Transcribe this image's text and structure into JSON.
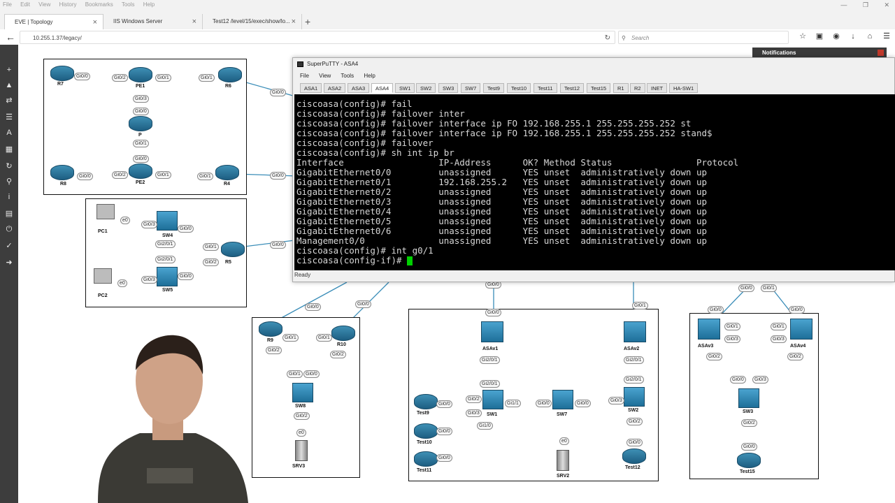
{
  "browser": {
    "menu": [
      "File",
      "Edit",
      "View",
      "History",
      "Bookmarks",
      "Tools",
      "Help"
    ],
    "tabs": [
      {
        "label": "EVE | Topology",
        "active": true
      },
      {
        "label": "IIS Windows Server",
        "active": false
      },
      {
        "label": "Test12 /level/15/exec/show/lo...",
        "active": false
      }
    ],
    "url": "10.255.1.37/legacy/",
    "search_placeholder": "Search"
  },
  "notifications": {
    "title": "Notifications"
  },
  "putty": {
    "title": "SuperPuTTY - ASA4",
    "menu": [
      "File",
      "View",
      "Tools",
      "Help"
    ],
    "tabs": [
      "ASA1",
      "ASA2",
      "ASA3",
      "ASA4",
      "SW1",
      "SW2",
      "SW3",
      "SW7",
      "Test9",
      "Test10",
      "Test11",
      "Test12",
      "Test15",
      "R1",
      "R2",
      "INET",
      "HA-SW1"
    ],
    "active_tab": "ASA4",
    "status": "Ready",
    "terminal_lines": [
      "ciscoasa(config)# fail",
      "ciscoasa(config)# failover inter",
      "ciscoasa(config)# failover interface ip FO 192.168.255.1 255.255.255.252 st",
      "ciscoasa(config)# failover interface ip FO 192.168.255.1 255.255.255.252 stand$",
      "ciscoasa(config)# failover",
      "ciscoasa(config)# sh int ip br",
      "Interface                  IP-Address      OK? Method Status                Protocol",
      "GigabitEthernet0/0         unassigned      YES unset  administratively down up",
      "GigabitEthernet0/1         192.168.255.2   YES unset  administratively down up",
      "GigabitEthernet0/2         unassigned      YES unset  administratively down up",
      "GigabitEthernet0/3         unassigned      YES unset  administratively down up",
      "GigabitEthernet0/4         unassigned      YES unset  administratively down up",
      "GigabitEthernet0/5         unassigned      YES unset  administratively down up",
      "GigabitEthernet0/6         unassigned      YES unset  administratively down up",
      "Management0/0              unassigned      YES unset  administratively down up",
      "ciscoasa(config)# int g0/1",
      "ciscoasa(config-if)# "
    ]
  },
  "topology": {
    "devices": [
      {
        "name": "R7",
        "type": "router"
      },
      {
        "name": "PE1",
        "type": "router"
      },
      {
        "name": "R6",
        "type": "router"
      },
      {
        "name": "P",
        "type": "router"
      },
      {
        "name": "R8",
        "type": "router"
      },
      {
        "name": "PE2",
        "type": "router"
      },
      {
        "name": "R4",
        "type": "router"
      },
      {
        "name": "PC1",
        "type": "pc"
      },
      {
        "name": "SW4",
        "type": "switch"
      },
      {
        "name": "R5",
        "type": "router"
      },
      {
        "name": "PC2",
        "type": "pc"
      },
      {
        "name": "SW5",
        "type": "switch"
      },
      {
        "name": "R9",
        "type": "router"
      },
      {
        "name": "R10",
        "type": "router"
      },
      {
        "name": "SW8",
        "type": "switch"
      },
      {
        "name": "SRV3",
        "type": "server"
      },
      {
        "name": "ASAv1",
        "type": "asa"
      },
      {
        "name": "ASAv2",
        "type": "asa"
      },
      {
        "name": "Test9",
        "type": "router"
      },
      {
        "name": "SW1",
        "type": "switch"
      },
      {
        "name": "SW7",
        "type": "switch"
      },
      {
        "name": "SW2",
        "type": "switch"
      },
      {
        "name": "Test10",
        "type": "router"
      },
      {
        "name": "Test11",
        "type": "router"
      },
      {
        "name": "SRV2",
        "type": "server"
      },
      {
        "name": "Test12",
        "type": "router"
      },
      {
        "name": "ASAv3",
        "type": "asa"
      },
      {
        "name": "ASAv4",
        "type": "asa"
      },
      {
        "name": "SW3",
        "type": "switch"
      },
      {
        "name": "Test15",
        "type": "router"
      }
    ],
    "ports": [
      "Gi0/0",
      "Gi0/1",
      "Gi0/2",
      "Gi0/3",
      "Gi1/0",
      "Gi1/1",
      "Gi2/0/1",
      "e0"
    ]
  }
}
